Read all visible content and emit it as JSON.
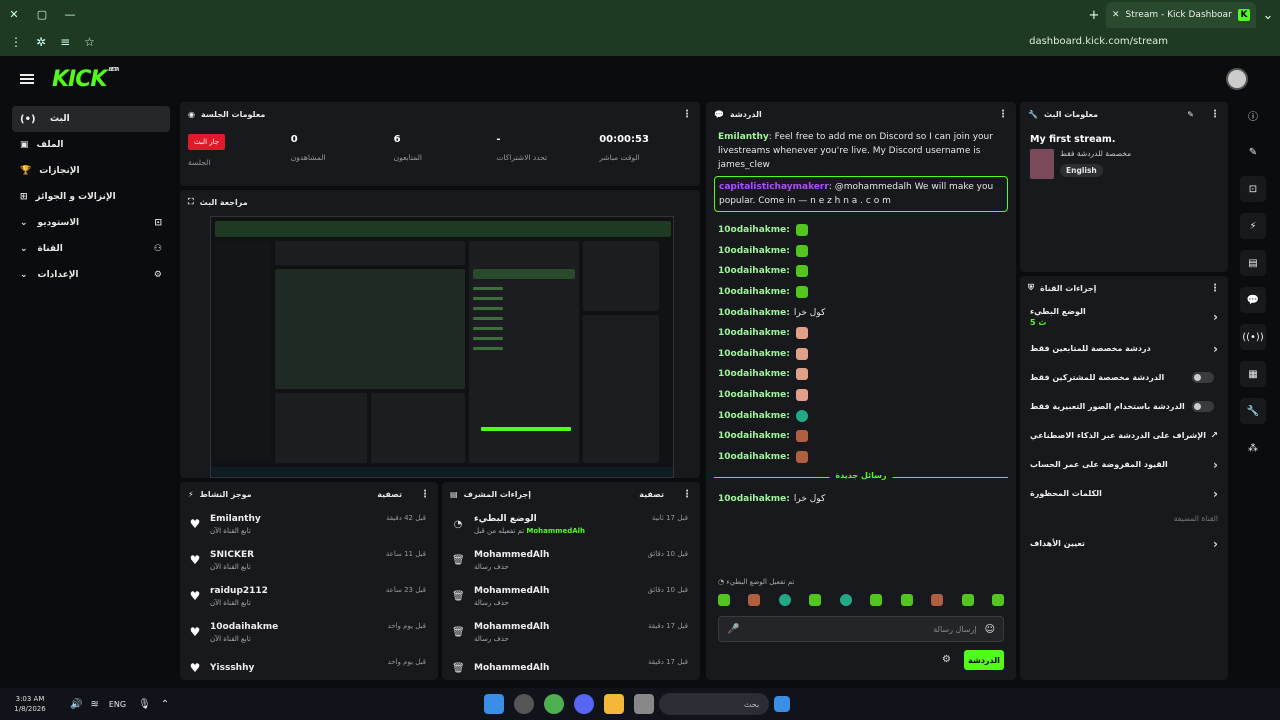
{
  "browser": {
    "tab_title": "Stream - Kick Dashboard",
    "favicon": "K",
    "url": "dashboard.kick.com/stream"
  },
  "header": {
    "logo": "KICK",
    "beta": "BETA"
  },
  "sidenav": {
    "items": [
      {
        "label": "البث",
        "icon": "(•)"
      },
      {
        "label": "الملف",
        "icon": "▣"
      },
      {
        "label": "الإنجازات",
        "icon": "🏆"
      },
      {
        "label": "الإنزالات و الجوائز",
        "icon": "⊞"
      },
      {
        "label": "الاستوديو",
        "icon": "⊡"
      },
      {
        "label": "القناة",
        "icon": "⚇"
      },
      {
        "label": "الإعدادات",
        "icon": "⚙"
      }
    ]
  },
  "session": {
    "title": "معلومات الجلسة",
    "stats": [
      {
        "value": "جار البث",
        "label": "الجلسة"
      },
      {
        "value": "0",
        "label": "المشاهدون"
      },
      {
        "value": "6",
        "label": "المتابعون"
      },
      {
        "value": "-",
        "label": "تحدد الاشتراكات"
      },
      {
        "value": "00:00:53",
        "label": "الوقت مباشر"
      }
    ]
  },
  "preview": {
    "title": "مراجعة البث"
  },
  "activity": {
    "title": "موجز النشاط",
    "filter": "تصفية",
    "items": [
      {
        "name": "Emilanthy",
        "sub": "تابع القناة الآن",
        "time": "قبل 42 دقيقة"
      },
      {
        "name": "SNICKER",
        "sub": "تابع القناة الآن",
        "time": "قبل 11 ساعة"
      },
      {
        "name": "raidup2112",
        "sub": "تابع القناة الآن",
        "time": "قبل 23 ساعة"
      },
      {
        "name": "10odaihakme",
        "sub": "تابع القناة الآن",
        "time": "قبل يوم واحد"
      },
      {
        "name": "Yissshhy",
        "sub": "",
        "time": "قبل يوم واحد"
      }
    ]
  },
  "modactions": {
    "title": "إجراءات المشرف",
    "filter": "تصفية",
    "items": [
      {
        "name": "الوضع البطيء",
        "sub": "تم تفعيله من قبل",
        "highlight": "MohammedAlh",
        "time": "قبل 17 ثانية"
      },
      {
        "name": "MohammedAlh",
        "sub": "حذف رسالة",
        "highlight": "",
        "time": "قبل 10 دقائق"
      },
      {
        "name": "MohammedAlh",
        "sub": "حذف رسالة",
        "highlight": "",
        "time": "قبل 10 دقائق"
      },
      {
        "name": "MohammedAlh",
        "sub": "حذف رسالة",
        "highlight": "",
        "time": "قبل 17 دقيقة"
      },
      {
        "name": "MohammedAlh",
        "sub": "",
        "highlight": "",
        "time": "قبل 17 دقيقة"
      }
    ]
  },
  "chat": {
    "title": "الدردشة",
    "pinned_user": "Emilanthy",
    "pinned_text": "Feel free to add me on Discord so I can join your livestreams whenever you're live. My Discord username is james_clew",
    "reply_user": "capitalistichaymakerr",
    "reply_text": ": @mohammedalh We will make you popular. Come in — n e z h n a . c o m",
    "messages": [
      {
        "user": "10odaihakme:",
        "text": "",
        "emote": "em-green"
      },
      {
        "user": "10odaihakme:",
        "text": "",
        "emote": "em-green"
      },
      {
        "user": "10odaihakme:",
        "text": "",
        "emote": "em-green"
      },
      {
        "user": "10odaihakme:",
        "text": "",
        "emote": "em-green"
      },
      {
        "user": "10odaihakme:",
        "text": "كول خرا",
        "emote": ""
      },
      {
        "user": "10odaihakme:",
        "text": "",
        "emote": "em-hand"
      },
      {
        "user": "10odaihakme:",
        "text": "",
        "emote": "em-hand"
      },
      {
        "user": "10odaihakme:",
        "text": "",
        "emote": "em-hand"
      },
      {
        "user": "10odaihakme:",
        "text": "",
        "emote": "em-hand"
      },
      {
        "user": "10odaihakme:",
        "text": "",
        "emote": "em-ball"
      },
      {
        "user": "10odaihakme:",
        "text": "",
        "emote": "em-face"
      },
      {
        "user": "10odaihakme:",
        "text": "",
        "emote": "em-face"
      }
    ],
    "new_messages": "رسائل جديدة",
    "last_user": "10odaihakme:",
    "last_text": "كول خرا",
    "slow_mode_notice": "تم تفعيل الوضع البطيء",
    "input_placeholder": "إرسال رسالة",
    "send_label": "الدردشة"
  },
  "streaminfo": {
    "title": "معلومات البث",
    "stream_title": "My first stream.",
    "category": "مخصصة للدردشة فقط",
    "language": "English"
  },
  "channel_actions": {
    "title": "إجراءات القناة",
    "rows": [
      {
        "label": "الوضع البطيء",
        "extra": "5 ث",
        "type": "arrow"
      },
      {
        "label": "دردشة مخصصة للمتابعين فقط",
        "type": "arrow"
      },
      {
        "label": "الدردشة مخصصة للمشتركين فقط",
        "type": "toggle"
      },
      {
        "label": "الدردشة باستخدام الصور التعبيرية فقط",
        "type": "toggle"
      },
      {
        "label": "الإشراف على الدردشة عبر الذكاء الاصطناعي",
        "type": "ext"
      },
      {
        "label": "القيود المفروضة على عمر الحساب",
        "type": "arrow"
      },
      {
        "label": "الكلمات المحظورة",
        "type": "arrow"
      }
    ],
    "promoted_label": "القناة المضيفة",
    "set_target": "تعيين الأهداف"
  },
  "taskbar": {
    "time": "3:03 AM",
    "date": "1/8/2026",
    "lang": "ENG",
    "search": "بحث"
  },
  "colors": {
    "accent": "#53fc18",
    "live": "#e0192b",
    "panel": "#18191c"
  }
}
